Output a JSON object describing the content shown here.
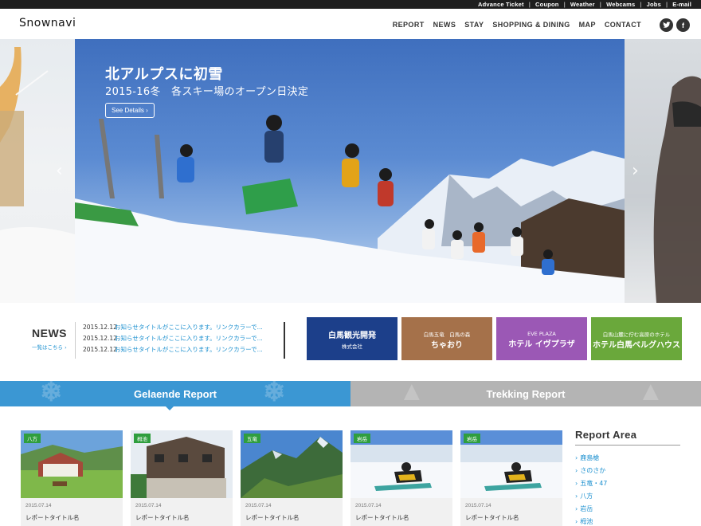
{
  "toplinks": [
    "Advance Ticket",
    "Coupon",
    "Weather",
    "Webcams",
    "Jobs",
    "E-mail"
  ],
  "logo": "Snownavi",
  "nav": [
    "REPORT",
    "NEWS",
    "STAY",
    "SHOPPING & DINING",
    "MAP",
    "CONTACT"
  ],
  "social": {
    "twitter": "t",
    "facebook": "f"
  },
  "hero": {
    "title": "北アルプスに初雪",
    "subtitle": "2015-16冬　各スキー場のオープン日決定",
    "button": "See Details ›",
    "prev": "‹",
    "next": "›"
  },
  "news": {
    "heading": "NEWS",
    "all_link": "一覧はこちら ›",
    "items": [
      {
        "date": "2015.12.12",
        "text": "お知らせタイトルがここに入ります。リンクカラーで..."
      },
      {
        "date": "2015.12.12",
        "text": "お知らせタイトルがここに入ります。リンクカラーで..."
      },
      {
        "date": "2015.12.12",
        "text": "お知らせタイトルがここに入ります。リンクカラーで..."
      }
    ]
  },
  "banners": [
    {
      "line1": "白馬観光開発",
      "line2": "株式会社",
      "color": "#1c3f8a"
    },
    {
      "line1": "ちゃおり",
      "line2": "白馬五竜　白馬の森",
      "color": "#a5714a"
    },
    {
      "line1": "ホテル イヴプラザ",
      "line2": "EVE PLAZA",
      "color": "#9b58b5"
    },
    {
      "line1": "ホテル白馬ベルグハウス",
      "line2": "白馬山麓に佇む高原のホテル",
      "color": "#6aa83b"
    }
  ],
  "tabs": {
    "gelaende": "Gelaende Report",
    "trekking": "Trekking Report"
  },
  "reports": [
    {
      "tag": "八方",
      "date": "2015.07.14",
      "title": "レポートタイトル名",
      "scene": "lodge"
    },
    {
      "tag": "栂池",
      "date": "2015.07.14",
      "title": "レポートタイトル名",
      "scene": "building"
    },
    {
      "tag": "五竜",
      "date": "2015.07.14",
      "title": "レポートタイトル名",
      "scene": "mountain"
    },
    {
      "tag": "岩岳",
      "date": "2015.07.14",
      "title": "レポートタイトル名",
      "scene": "snowboard"
    },
    {
      "tag": "岩岳",
      "date": "2015.07.14",
      "title": "レポートタイトル名",
      "scene": "snowboard"
    }
  ],
  "report_area": {
    "title": "Report Area",
    "items": [
      "鹿島槍",
      "さのさか",
      "五竜・47",
      "八方",
      "岩岳",
      "栂池"
    ]
  }
}
